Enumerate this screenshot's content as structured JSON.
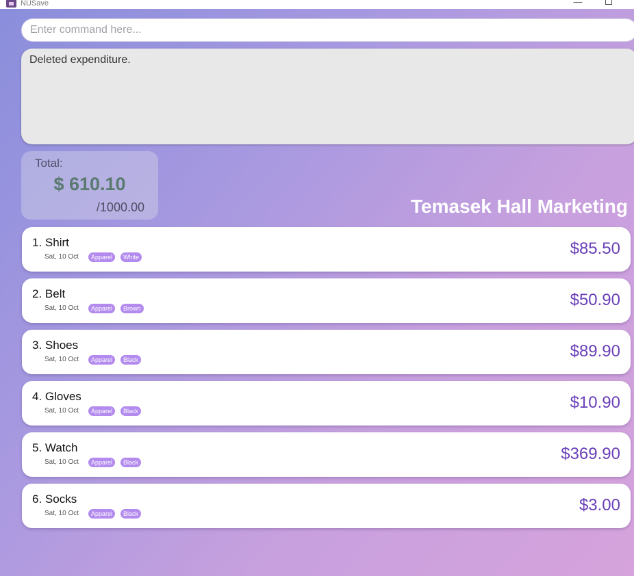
{
  "window": {
    "title": "NUSave",
    "minimize_glyph": "—"
  },
  "command": {
    "placeholder": "Enter command here..."
  },
  "result": {
    "message": "Deleted expenditure."
  },
  "total": {
    "label": "Total:",
    "amount": "$ 610.10",
    "budget": "/1000.00"
  },
  "account": {
    "name": "Temasek Hall Marketing"
  },
  "expenditures": [
    {
      "name": "1. Shirt",
      "date": "Sat, 10 Oct",
      "tags": [
        "Apparel",
        "White"
      ],
      "price": "$85.50"
    },
    {
      "name": "2. Belt",
      "date": "Sat, 10 Oct",
      "tags": [
        "Apparel",
        "Brown"
      ],
      "price": "$50.90"
    },
    {
      "name": "3. Shoes",
      "date": "Sat, 10 Oct",
      "tags": [
        "Apparel",
        "Black"
      ],
      "price": "$89.90"
    },
    {
      "name": "4. Gloves",
      "date": "Sat, 10 Oct",
      "tags": [
        "Apparel",
        "Black"
      ],
      "price": "$10.90"
    },
    {
      "name": "5. Watch",
      "date": "Sat, 10 Oct",
      "tags": [
        "Apparel",
        "Black"
      ],
      "price": "$369.90"
    },
    {
      "name": "6. Socks",
      "date": "Sat, 10 Oct",
      "tags": [
        "Apparel",
        "Black"
      ],
      "price": "$3.00"
    }
  ],
  "colors": {
    "accent": "#6a3fb8",
    "tag": "#b38aee",
    "total_amount": "#5a7a70"
  },
  "icons": {
    "app": "app-icon",
    "minimize": "minimize-icon",
    "maximize": "maximize-icon"
  }
}
